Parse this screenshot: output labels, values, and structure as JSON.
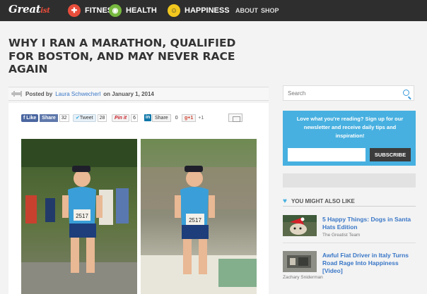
{
  "nav": {
    "logo": "Great",
    "logo_suffix": "ist",
    "items": [
      {
        "label": "FITNESS",
        "icon": "fitness-icon",
        "color": "#e94d3b",
        "glyph": "✚"
      },
      {
        "label": "HEALTH",
        "icon": "health-icon",
        "color": "#76b83f",
        "glyph": "◉"
      },
      {
        "label": "HAPPINESS",
        "icon": "happiness-icon",
        "color": "#f2c81e",
        "glyph": "☺"
      }
    ],
    "about": "ABOUT",
    "shop": "SHOP"
  },
  "article": {
    "title": "WHY I RAN A MARATHON, QUALIFIED FOR BOSTON, AND MAY NEVER RACE AGAIN",
    "posted_by": "Posted by",
    "author": "Laura Schwecherl",
    "date": "on January 1, 2014"
  },
  "share": {
    "fb_like": "Like",
    "fb_share": "Share",
    "fb_count": "32",
    "tweet": "Tweet",
    "tweet_count": "28",
    "pin": "Pin it",
    "pin_count": "6",
    "in_share": "Share",
    "in_count": "0",
    "gplus": "g+1",
    "gplus_count": "+1"
  },
  "sidebar": {
    "search_placeholder": "Search",
    "newsletter_text": "Love what you're reading? Sign up for our newsletter and receive daily tips and inspiration!",
    "subscribe": "SUBSCRIBE",
    "might_like": "YOU MIGHT ALSO LIKE",
    "related": [
      {
        "title": "5 Happy Things: Dogs in Santa Hats Edition",
        "author": "The Greatist Team"
      },
      {
        "title": "Awful Fiat Driver in Italy Turns Road Rage Into Happiness [Video]",
        "author": "Zachary Sniderman"
      }
    ]
  },
  "colors": {
    "accent_blue": "#47b0e0",
    "link_blue": "#3a77c7",
    "nav_bg": "#2e2e2e"
  }
}
